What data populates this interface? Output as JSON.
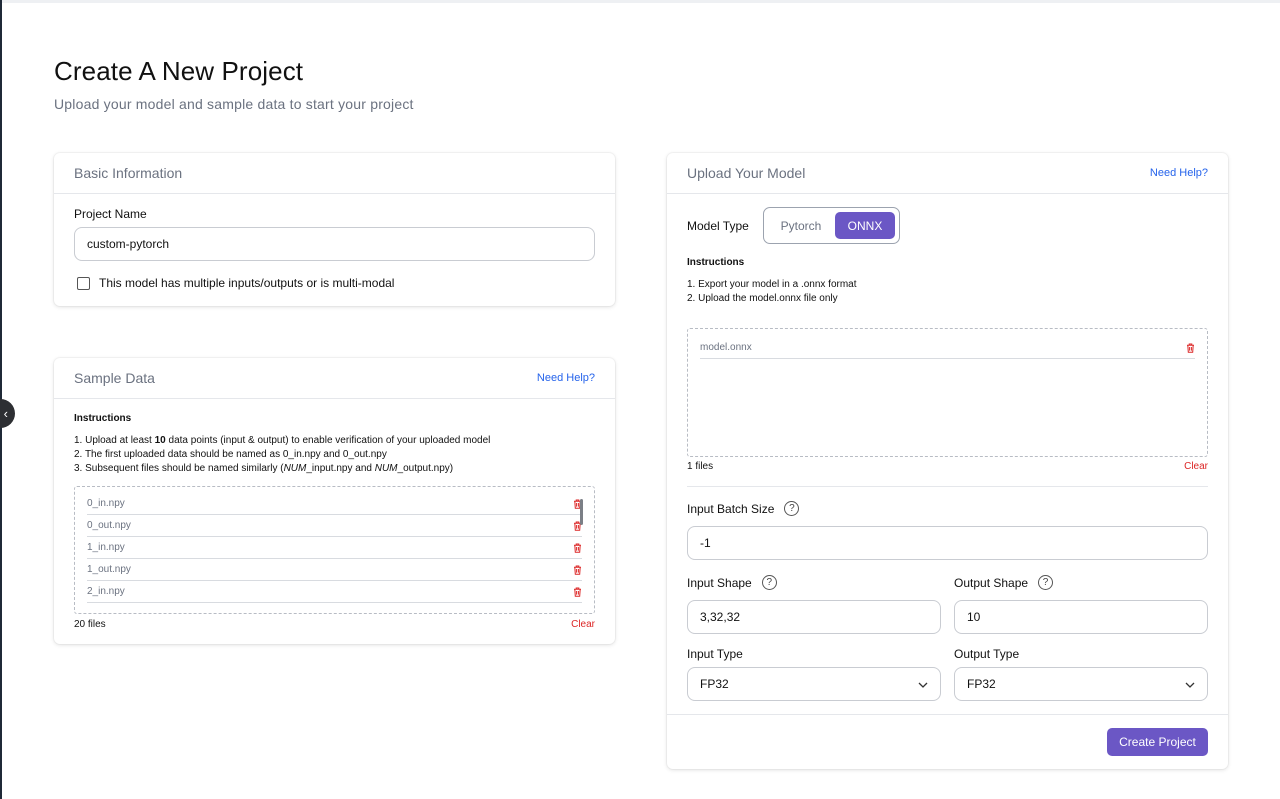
{
  "page": {
    "title": "Create A New Project",
    "subtitle": "Upload your model and sample data to start your project"
  },
  "basic_info": {
    "title": "Basic Information",
    "project_name_label": "Project Name",
    "project_name_value": "custom-pytorch",
    "multi_modal_checkbox_label": "This model has multiple inputs/outputs or is multi-modal",
    "multi_modal_checked": false
  },
  "sample_data": {
    "title": "Sample Data",
    "help_link": "Need Help?",
    "instructions_title": "Instructions",
    "instruction_1_prefix": "1. Upload at least ",
    "instruction_1_bold": "10",
    "instruction_1_suffix": " data points (input & output) to enable verification of your uploaded model",
    "instruction_2": "2. The first uploaded data should be named as 0_in.npy and 0_out.npy",
    "instruction_3_a": "3. Subsequent files should be named similarly (",
    "instruction_3_i1": "NUM",
    "instruction_3_b": "_input.npy and ",
    "instruction_3_i2": "NUM",
    "instruction_3_c": "_output.npy)",
    "files": [
      "0_in.npy",
      "0_out.npy",
      "1_in.npy",
      "1_out.npy",
      "2_in.npy"
    ],
    "files_count": "20 files",
    "clear_label": "Clear"
  },
  "upload_model": {
    "title": "Upload Your Model",
    "help_link": "Need Help?",
    "model_type_label": "Model Type",
    "model_type_options": [
      "Pytorch",
      "ONNX"
    ],
    "model_type_selected": "ONNX",
    "instructions_title": "Instructions",
    "instruction_1": "1. Export your model in a .onnx format",
    "instruction_2": "2. Upload the model.onnx file only",
    "files": [
      "model.onnx"
    ],
    "files_count": "1 files",
    "clear_label": "Clear",
    "input_batch_size_label": "Input Batch Size",
    "input_batch_size_value": "-1",
    "input_shape_label": "Input Shape",
    "input_shape_value": "3,32,32",
    "output_shape_label": "Output Shape",
    "output_shape_value": "10",
    "input_type_label": "Input Type",
    "input_type_value": "FP32",
    "output_type_label": "Output Type",
    "output_type_value": "FP32",
    "help_icon_glyph": "?",
    "create_button": "Create Project"
  },
  "colors": {
    "accent": "#6b57c5",
    "link": "#2563eb",
    "danger": "#dc2626"
  }
}
